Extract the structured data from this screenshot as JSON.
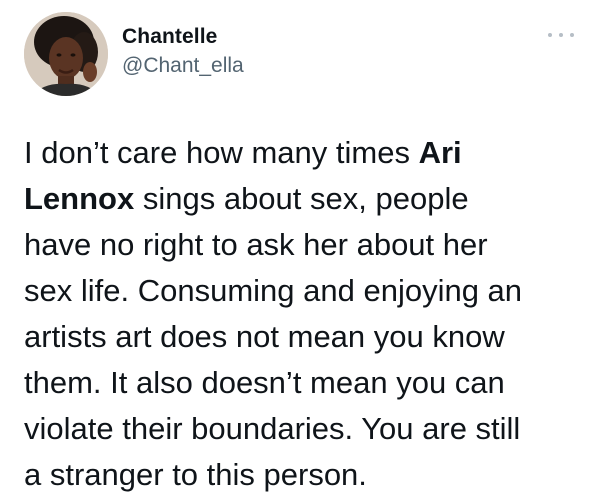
{
  "author": {
    "display_name": "Chantelle",
    "handle": "@Chant_ella",
    "avatar_icon": "profile-photo-icon"
  },
  "menu": {
    "icon": "more-horizontal-icon"
  },
  "tweet": {
    "segments": [
      {
        "text": "I don’t care how many times ",
        "bold": false
      },
      {
        "text": "Ari\nLennox",
        "bold": true
      },
      {
        "text": " sings about sex, people\nhave no right to ask her about her\nsex life. Consuming and enjoying an\nartists art does not mean you know\nthem. It also doesn’t mean you can\nviolate their boundaries. You are still\na stranger to this person.",
        "bold": false
      }
    ]
  },
  "colors": {
    "text": "#0f1419",
    "secondary": "#536471",
    "icon": "#b6bec6"
  }
}
